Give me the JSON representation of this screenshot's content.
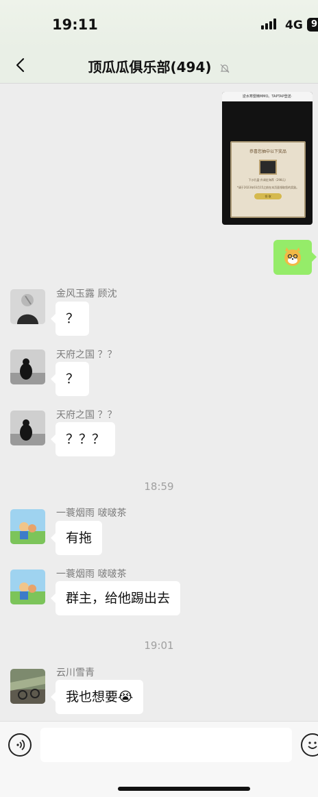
{
  "status_bar": {
    "time": "19:11",
    "network": "4G",
    "battery": "9"
  },
  "nav": {
    "title": "顶瓜瓜俱乐部(494)"
  },
  "image_message": {
    "header": "逆水寒暨精MMO。TAPTAP登送·",
    "dialog_title": "恭喜您抽中以下奖品",
    "dialog_item": "下沙孔盘·升调定海荐（298元）",
    "dialog_note": "*请于2023年03月15之前在本页面领取您的奖励。",
    "dialog_button": "领 取"
  },
  "messages": [
    {
      "sender": "金风玉露 顾沈",
      "text": "？"
    },
    {
      "sender": "天府之国 ？？",
      "text": "？"
    },
    {
      "sender": "天府之国 ？？",
      "text": "？？？"
    },
    {
      "time": "18:59"
    },
    {
      "sender": "一蓑烟雨 啵啵茶",
      "text": "有拖"
    },
    {
      "sender": "一蓑烟雨 啵啵茶",
      "text": "群主，给他踢出去"
    },
    {
      "time": "19:01"
    },
    {
      "sender": "云川雪青",
      "text": "我也想要😭"
    }
  ],
  "icons": {
    "back": "chevron-left-icon",
    "mute": "bell-slash-icon",
    "voice": "voice-icon",
    "emoji": "smiley-icon"
  }
}
